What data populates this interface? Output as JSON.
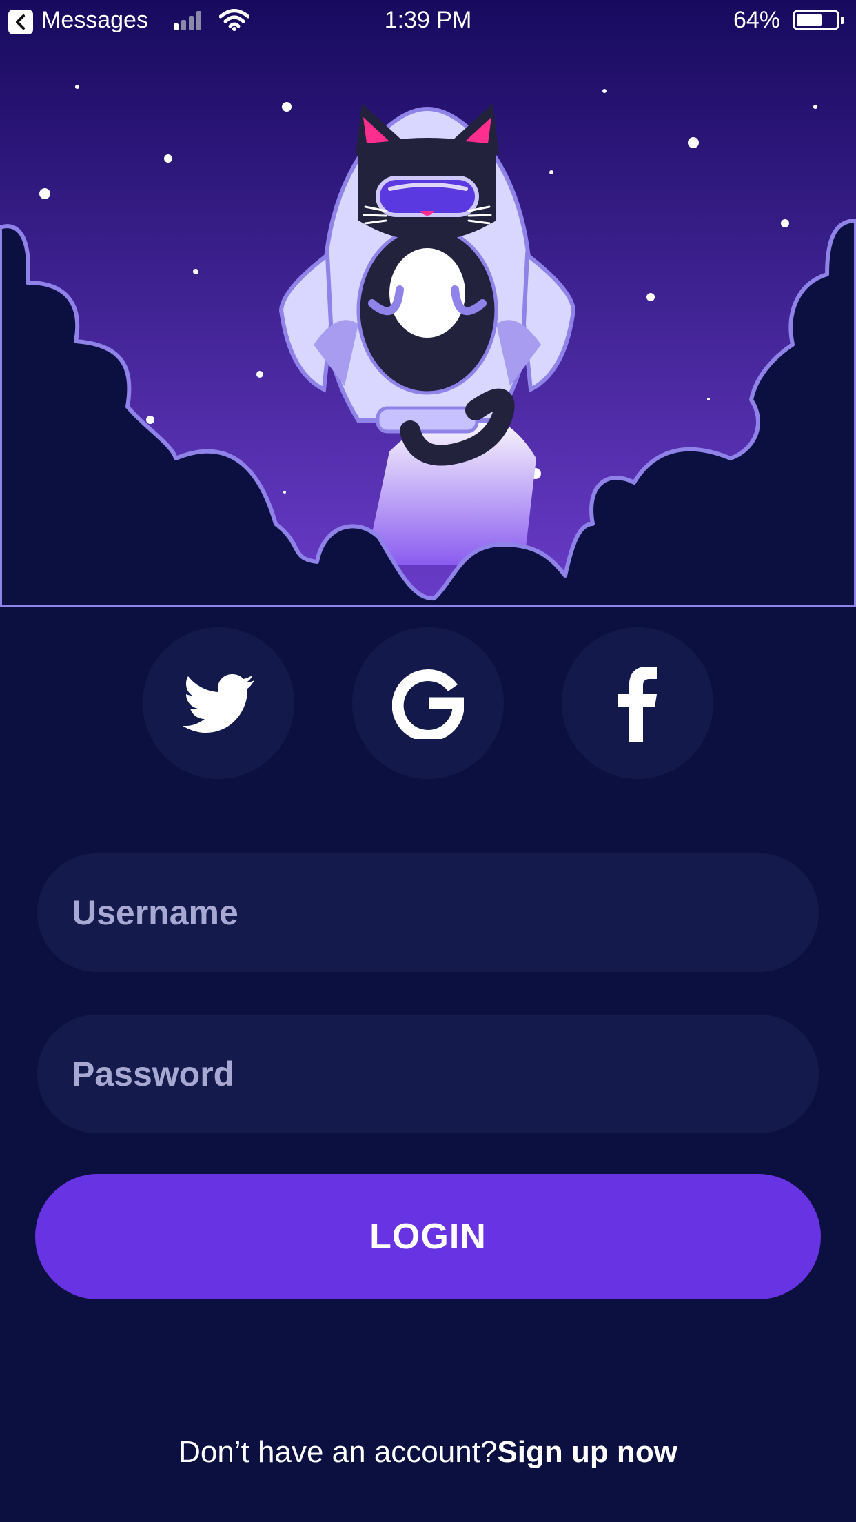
{
  "status_bar": {
    "back_app": "Messages",
    "time": "1:39 PM",
    "battery": "64%",
    "battery_level": 0.64,
    "icons": [
      "chevron-left-icon",
      "cellular-signal-icon",
      "wifi-icon",
      "battery-icon"
    ]
  },
  "hero": {
    "illustration": "cat-astronaut-rocket-illustration",
    "colors": {
      "sky_top": "#170a5e",
      "sky_bottom": "#6a3cc9",
      "cloud": "#0c1040",
      "cloud_outline": "#8f82e8",
      "rocket": "#d9d6ff"
    }
  },
  "social": [
    {
      "name": "twitter",
      "icon": "twitter-bird-icon"
    },
    {
      "name": "google",
      "icon": "google-g-icon"
    },
    {
      "name": "facebook",
      "icon": "facebook-f-icon"
    }
  ],
  "form": {
    "username_placeholder": "Username",
    "username_value": "",
    "password_placeholder": "Password",
    "password_value": "",
    "login_label": "LOGIN"
  },
  "footer": {
    "prompt": "Don’t have an account?",
    "signup_label": "Sign up now"
  },
  "colors": {
    "background": "#0c1040",
    "input_bg": "#141a4c",
    "social_bg": "#131a4b",
    "accent": "#6833e2",
    "placeholder": "#a7a9d2"
  }
}
